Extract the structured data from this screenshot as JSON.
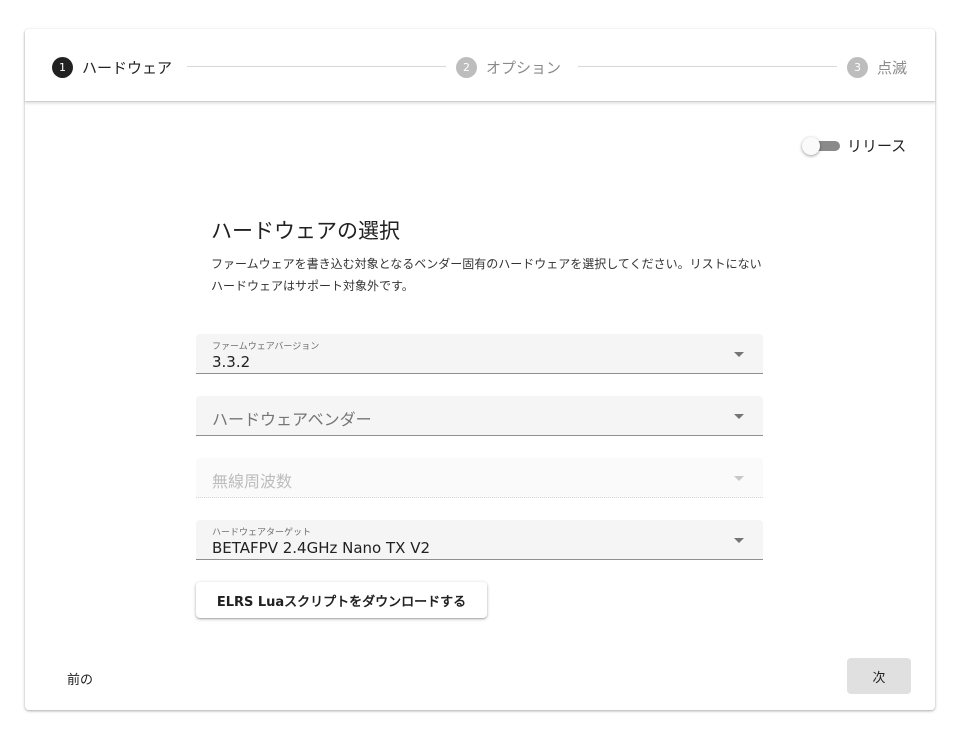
{
  "stepper": {
    "steps": [
      {
        "number": "1",
        "label": "ハードウェア",
        "state": "active"
      },
      {
        "number": "2",
        "label": "オプション",
        "state": "inactive"
      },
      {
        "number": "3",
        "label": "点滅",
        "state": "inactive"
      }
    ]
  },
  "release_toggle": {
    "label": "リリース",
    "checked": false
  },
  "hardware": {
    "title": "ハードウェアの選択",
    "description": "ファームウェアを書き込む対象となるベンダー固有のハードウェアを選択してください。リストにないハードウェアはサポート対象外です。"
  },
  "fields": {
    "firmware_version": {
      "label": "ファームウェアバージョン",
      "value": "3.3.2"
    },
    "hardware_vendor": {
      "placeholder": "ハードウェアベンダー"
    },
    "radio_frequency": {
      "placeholder": "無線周波数",
      "disabled": true
    },
    "hardware_target": {
      "label": "ハードウェアターゲット",
      "value": "BETAFPV 2.4GHz Nano TX V2"
    }
  },
  "download_button": {
    "label": "ELRS Luaスクリプトをダウンロードする"
  },
  "nav": {
    "prev_label": "前の",
    "next_label": "次"
  },
  "colors": {
    "active_step": "#212121",
    "inactive_step": "#bdbdbd",
    "field_bg": "#f5f5f5",
    "next_button_bg": "#e0e0e0"
  }
}
